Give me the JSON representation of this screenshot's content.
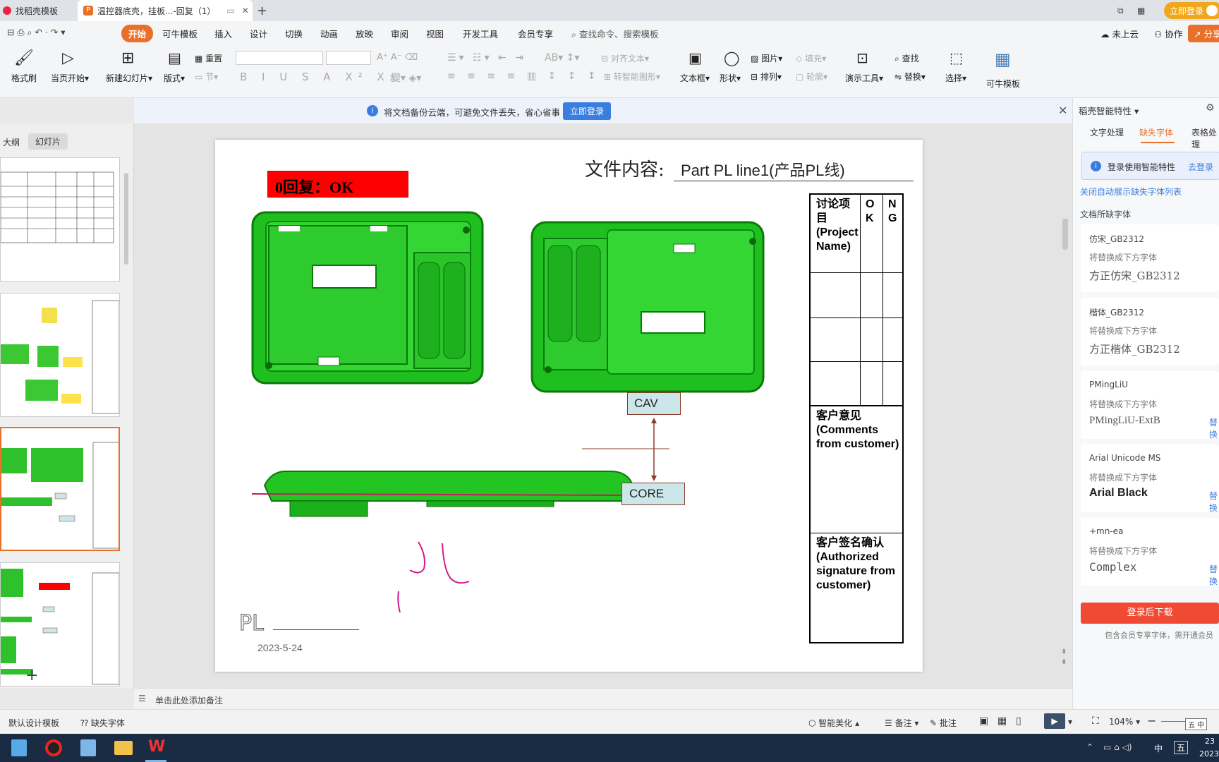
{
  "tabs": {
    "tab1": "找稻壳模板",
    "tab2": "温控器底壳，挂板...-回复（1）",
    "login_btn": "立即登录"
  },
  "menu": {
    "start": "开始",
    "items": [
      "可牛模板",
      "插入",
      "设计",
      "切换",
      "动画",
      "放映",
      "审阅",
      "视图",
      "开发工具",
      "会员专享"
    ],
    "search": "查找命令、搜索模板",
    "cloud": "未上云",
    "collab": "协作",
    "share": "分享"
  },
  "ribbon": {
    "format_painter": "格式刷",
    "from_current": "当页开始",
    "new_slide": "新建幻灯片",
    "layout": "版式",
    "reset": "重置",
    "section": "节",
    "align_text": "对齐文本",
    "smart_shape": "转智能图形",
    "textbox": "文本框",
    "shape": "形状",
    "picture": "图片",
    "fill": "填充",
    "arrange": "排列",
    "outline": "轮廓",
    "present_tool": "演示工具",
    "find": "查找",
    "replace": "替换",
    "select": "选择",
    "kn_template": "可牛模板"
  },
  "notify": {
    "text": "将文档备份云端，可避免文件丢失，省心省事",
    "button": "立即登录"
  },
  "left": {
    "outline_tab": "大纲",
    "slides_tab": "幻灯片"
  },
  "slide": {
    "content_label": "文件内容:",
    "content_value": "Part PL line1(产品PL线)",
    "reply": "0回复：OK",
    "cav": "CAV",
    "core": "CORE",
    "pl_label": "PL",
    "date": "2023-5-24",
    "table": {
      "header_item": "讨论项目(Project Name)",
      "header_ok": "OK",
      "header_ng": "NG",
      "comments": "客户意见(Comments from customer)",
      "signature": "客户签名确认(Authorized signature from customer)"
    }
  },
  "notes_placeholder": "单击此处添加备注",
  "right": {
    "title": "稻壳智能特性",
    "tabs": [
      "文字处理",
      "缺失字体",
      "表格处理"
    ],
    "login_tip": "登录使用智能特性",
    "login_link": "去登录",
    "close_auto": "关闭自动展示缺失字体列表",
    "missing_title": "文档所缺字体",
    "replace_hint": "将替换成下方字体",
    "replace_link": "替换",
    "fonts": [
      {
        "name": "仿宋_GB2312",
        "replacement": "方正仿宋_GB2312"
      },
      {
        "name": "楷体_GB2312",
        "replacement": "方正楷体_GB2312"
      },
      {
        "name": "PMingLiU",
        "replacement": "PMingLiU-ExtB"
      },
      {
        "name": "Arial Unicode MS",
        "replacement": "Arial Black"
      },
      {
        "name": "+mn-ea",
        "replacement": "Complex"
      }
    ],
    "download_btn": "登录后下载",
    "download_note": "包含会员专享字体，需开通会员"
  },
  "status": {
    "default_template": "默认设计模板",
    "missing_font": "缺失字体",
    "beautify": "智能美化",
    "notes": "备注",
    "comments": "批注",
    "zoom": "104%"
  },
  "taskbar": {
    "ime_lang": "中",
    "ime_mode": "五",
    "time": "23",
    "date": "2023"
  }
}
